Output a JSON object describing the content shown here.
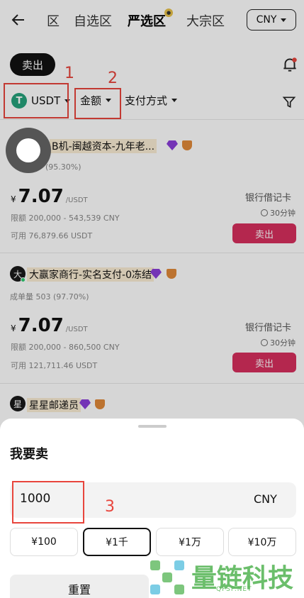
{
  "nav": {
    "tabs": [
      {
        "label": "区"
      },
      {
        "label": "自选区"
      },
      {
        "label": "严选区"
      },
      {
        "label": "大宗区"
      }
    ],
    "currency": "CNY"
  },
  "action_pill": "卖出",
  "filters": {
    "coin": "USDT",
    "coin_glyph": "T",
    "amount": "金额",
    "payment": "支付方式"
  },
  "annotations": [
    "1",
    "2",
    "3"
  ],
  "listings": [
    {
      "name": "B机-闽越资本-九年老...",
      "stats": "(95.30%)",
      "price": "7.07",
      "unit": "/USDT",
      "limit": "限额 200,000 - 543,539 CNY",
      "available": "可用 76,879.66 USDT",
      "payment": "银行借记卡",
      "time": "30分钟",
      "button": "卖出"
    },
    {
      "avatar": "大",
      "name": "大赢家商行-实名支付-0冻结",
      "stats": "成单量 503 (97.70%)",
      "price": "7.07",
      "unit": "/USDT",
      "limit": "限额 200,000 - 860,500 CNY",
      "available": "可用 121,711.46 USDT",
      "payment": "银行借记卡",
      "time": "30分钟",
      "button": "卖出"
    },
    {
      "avatar": "星",
      "name": "星星邮递员"
    }
  ],
  "currency_symbol": "¥",
  "sheet": {
    "title": "我要卖",
    "amount_value": "1000",
    "amount_currency": "CNY",
    "quick_amounts": [
      "¥100",
      "¥1千",
      "¥1万",
      "¥10万"
    ],
    "selected_index": 1,
    "reset": "重置"
  },
  "watermark": {
    "text": "量链科技",
    "sub": "QFSP.NET"
  }
}
